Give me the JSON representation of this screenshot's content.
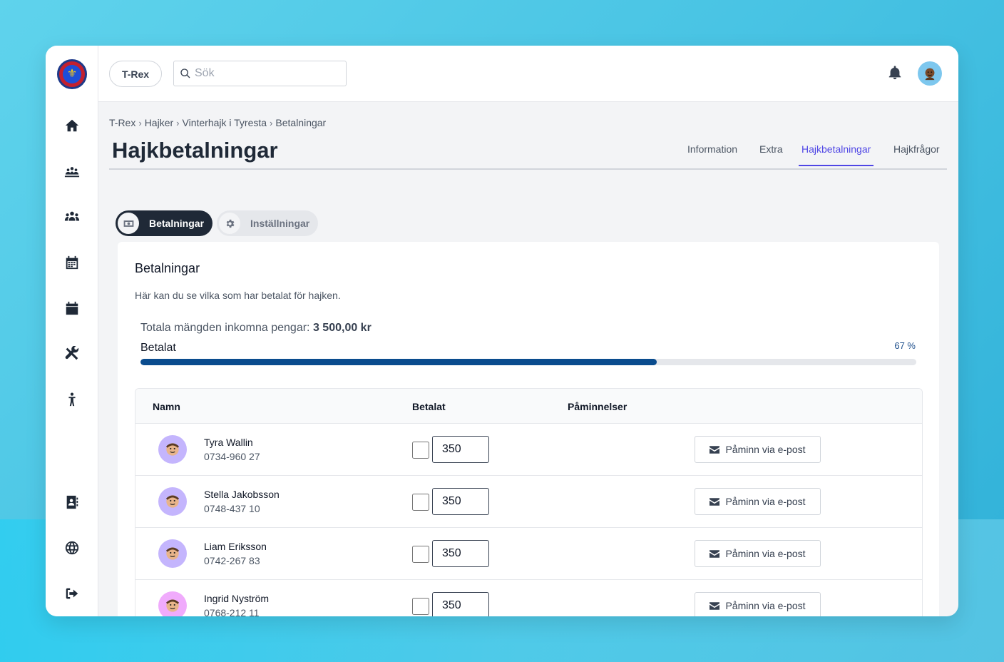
{
  "topbar": {
    "org_button": "T-Rex",
    "search_placeholder": "Sök"
  },
  "breadcrumb": [
    "T-Rex",
    "Hajker",
    "Vinterhajk i Tyresta",
    "Betalningar"
  ],
  "page_title": "Hajkbetalningar",
  "tabs": [
    {
      "label": "Information",
      "active": false
    },
    {
      "label": "Extra",
      "active": false
    },
    {
      "label": "Hajkbetalningar",
      "active": true
    },
    {
      "label": "Hajkfrågor",
      "active": false
    }
  ],
  "pills": [
    {
      "label": "Betalningar",
      "icon": "money-icon",
      "active": true
    },
    {
      "label": "Inställningar",
      "icon": "gear-icon",
      "active": false
    }
  ],
  "card": {
    "title": "Betalningar",
    "description": "Här kan du se vilka som har betalat för hajken.",
    "total_label": "Totala mängden inkomna pengar:",
    "total_value": "3 500,00 kr",
    "paid_label": "Betalat",
    "paid_percent_text": "67 %",
    "paid_fraction": 0.665
  },
  "table": {
    "headers": {
      "name": "Namn",
      "paid": "Betalat",
      "reminders": "Påminnelser"
    },
    "remind_label": "Påminn via e-post",
    "rows": [
      {
        "name": "Tyra Wallin",
        "phone": "0734-960 27",
        "amount": "350",
        "paid": false,
        "avatar_color": "#c4b5fd"
      },
      {
        "name": "Stella Jakobsson",
        "phone": "0748-437 10",
        "amount": "350",
        "paid": false,
        "avatar_color": "#c4b5fd"
      },
      {
        "name": "Liam Eriksson",
        "phone": "0742-267 83",
        "amount": "350",
        "paid": false,
        "avatar_color": "#c4b5fd"
      },
      {
        "name": "Ingrid Nyström",
        "phone": "0768-212 11",
        "amount": "350",
        "paid": false,
        "avatar_color": "#f0abfc"
      }
    ]
  },
  "colors": {
    "accent": "#4f46e5",
    "progress": "#0a4c8e",
    "dark_pill": "#1f2937"
  }
}
